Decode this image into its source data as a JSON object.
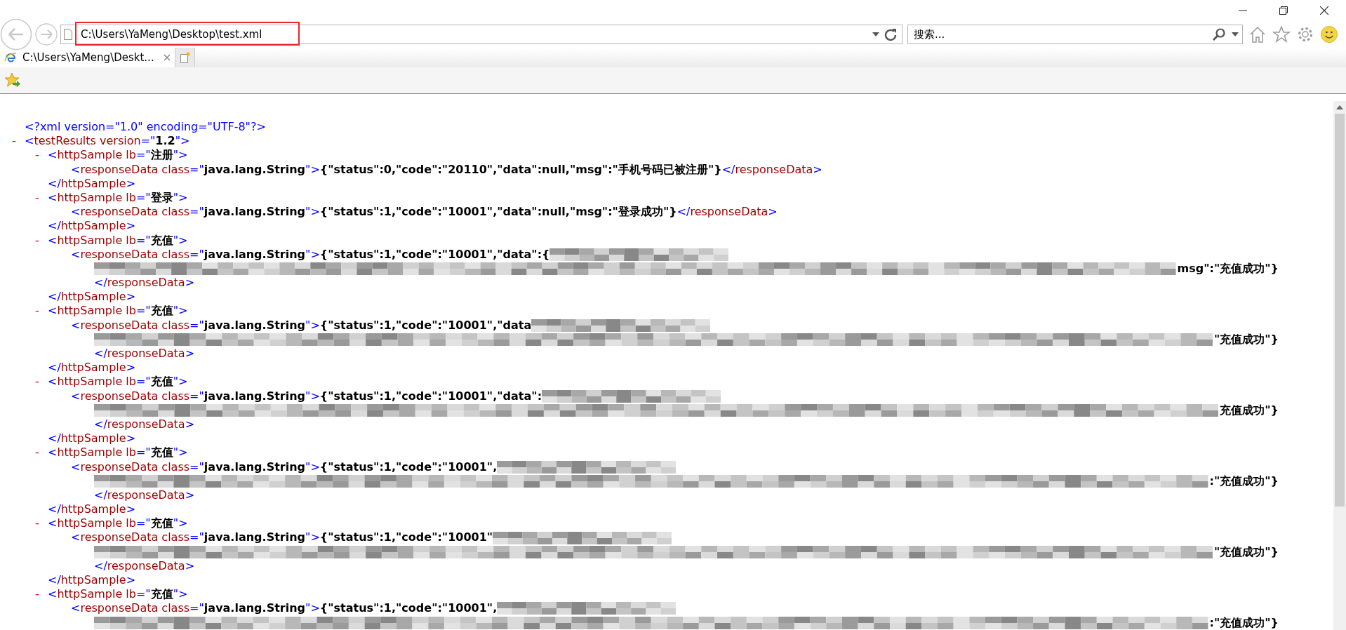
{
  "address_bar": {
    "value": "C:\\Users\\YaMeng\\Desktop\\test.xml",
    "highlighted": true
  },
  "search_field": {
    "placeholder": "搜索..."
  },
  "tabs": [
    {
      "label": "C:\\Users\\YaMeng\\Deskt...",
      "selected": true
    }
  ],
  "markup": {
    "lt": "<",
    "gt": ">",
    "close_lt": "</",
    "eq_quote": "=\"",
    "quote": "\"",
    "collapse": "-"
  },
  "xml": {
    "declaration": "<?xml version=\"1.0\" encoding=\"UTF-8\"?>",
    "root": {
      "tag": "testResults",
      "attrs": [
        {
          "name": "version",
          "value": "1.2"
        }
      ],
      "expanded": true,
      "children": [
        {
          "tag": "httpSample",
          "close_tag": "httpSample",
          "attrs": [
            {
              "name": "lb",
              "value": "注册"
            }
          ],
          "expanded": true,
          "children": [
            {
              "tag": "responseData",
              "close_tag": "responseData",
              "attrs": [
                {
                  "name": "class",
                  "value": "java.lang.String"
                }
              ],
              "text": "{\"status\":0,\"code\":\"20110\",\"data\":null,\"msg\":\"手机号码已被注册\"}",
              "redacted": false
            }
          ]
        },
        {
          "tag": "httpSample",
          "close_tag": "httpSample",
          "attrs": [
            {
              "name": "lb",
              "value": "登录"
            }
          ],
          "expanded": true,
          "children": [
            {
              "tag": "responseData",
              "close_tag": "responseData",
              "attrs": [
                {
                  "name": "class",
                  "value": "java.lang.String"
                }
              ],
              "text": "{\"status\":1,\"code\":\"10001\",\"data\":null,\"msg\":\"登录成功\"}",
              "redacted": false
            }
          ]
        },
        {
          "tag": "httpSample",
          "close_tag": "httpSample",
          "attrs": [
            {
              "name": "lb",
              "value": "充值"
            }
          ],
          "expanded": true,
          "children": [
            {
              "tag": "responseData",
              "close_tag": "responseData",
              "attrs": [
                {
                  "name": "class",
                  "value": "java.lang.String"
                }
              ],
              "text": "{\"status\":1,\"code\":\"10001\",\"data\":{",
              "text_end": "msg\":\"充值成功\"}",
              "redacted": true
            }
          ]
        },
        {
          "tag": "httpSample",
          "close_tag": "httpSample",
          "attrs": [
            {
              "name": "lb",
              "value": "充值"
            }
          ],
          "expanded": true,
          "children": [
            {
              "tag": "responseData",
              "close_tag": "responseData",
              "attrs": [
                {
                  "name": "class",
                  "value": "java.lang.String"
                }
              ],
              "text": "{\"status\":1,\"code\":\"10001\",\"data",
              "text_end": "\"充值成功\"}",
              "redacted": true
            }
          ]
        },
        {
          "tag": "httpSample",
          "close_tag": "httpSample",
          "attrs": [
            {
              "name": "lb",
              "value": "充值"
            }
          ],
          "expanded": true,
          "children": [
            {
              "tag": "responseData",
              "close_tag": "responseData",
              "attrs": [
                {
                  "name": "class",
                  "value": "java.lang.String"
                }
              ],
              "text": "{\"status\":1,\"code\":\"10001\",\"data\":",
              "text_end": "充值成功\"}",
              "redacted": true
            }
          ]
        },
        {
          "tag": "httpSample",
          "close_tag": "httpSample",
          "attrs": [
            {
              "name": "lb",
              "value": "充值"
            }
          ],
          "expanded": true,
          "children": [
            {
              "tag": "responseData",
              "close_tag": "responseData",
              "attrs": [
                {
                  "name": "class",
                  "value": "java.lang.String"
                }
              ],
              "text": "{\"status\":1,\"code\":\"10001\",",
              "text_end": ":\"充值成功\"}",
              "redacted": true
            }
          ]
        },
        {
          "tag": "httpSample",
          "close_tag": "httpSample",
          "attrs": [
            {
              "name": "lb",
              "value": "充值"
            }
          ],
          "expanded": true,
          "children": [
            {
              "tag": "responseData",
              "close_tag": "responseData",
              "attrs": [
                {
                  "name": "class",
                  "value": "java.lang.String"
                }
              ],
              "text": "{\"status\":1,\"code\":\"10001\"",
              "text_end": "\"充值成功\"}",
              "redacted": true
            }
          ]
        },
        {
          "tag": "httpSample",
          "attrs": [
            {
              "name": "lb",
              "value": "充值"
            }
          ],
          "expanded": true,
          "children": [
            {
              "tag": "responseData",
              "attrs": [
                {
                  "name": "class",
                  "value": "java.lang.String"
                }
              ],
              "text": "{\"status\":1,\"code\":\"10001\",",
              "text_end": ":\"充值成功\"}",
              "redacted": true
            }
          ]
        }
      ]
    }
  }
}
